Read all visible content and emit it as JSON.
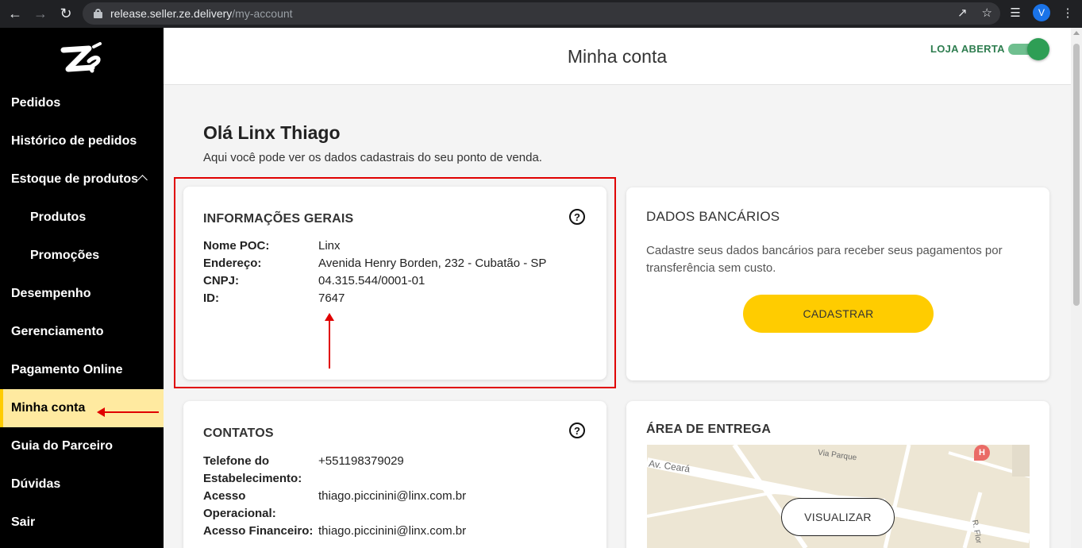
{
  "browser": {
    "url_host": "release.seller.ze.delivery",
    "url_path": "/my-account",
    "profile_initial": "V"
  },
  "sidebar": {
    "items": [
      {
        "label": "Pedidos"
      },
      {
        "label": "Histórico de pedidos"
      },
      {
        "label": "Estoque de produtos"
      },
      {
        "label": "Produtos"
      },
      {
        "label": "Promoções"
      },
      {
        "label": "Desempenho"
      },
      {
        "label": "Gerenciamento"
      },
      {
        "label": "Pagamento Online"
      },
      {
        "label": "Minha conta"
      },
      {
        "label": "Guia do Parceiro"
      },
      {
        "label": "Dúvidas"
      },
      {
        "label": "Sair"
      }
    ]
  },
  "header": {
    "title": "Minha conta",
    "store_status": "LOJA ABERTA"
  },
  "main": {
    "greeting": "Olá Linx Thiago",
    "subtitle": "Aqui você pode ver os dados cadastrais do seu ponto de venda."
  },
  "general_info": {
    "title": "INFORMAÇÕES GERAIS",
    "help": "?",
    "rows": [
      {
        "label": "Nome POC:",
        "value": "Linx"
      },
      {
        "label": "Endereço:",
        "value": "Avenida Henry Borden, 232 - Cubatão - SP"
      },
      {
        "label": "CNPJ:",
        "value": "04.315.544/0001-01"
      },
      {
        "label": "ID:",
        "value": "7647"
      }
    ]
  },
  "bank": {
    "title": "DADOS BANCÁRIOS",
    "text_line1": "Cadastre seus dados bancários para receber seus pagamentos por",
    "text_line2": "transferência sem custo.",
    "button": "CADASTRAR"
  },
  "contacts": {
    "title": "CONTATOS",
    "help": "?",
    "phone_label_1": "Telefone do",
    "phone_label_2": "Estabelecimento:",
    "phone_value": "+551198379029",
    "op_label_1": "Acesso",
    "op_label_2": "Operacional:",
    "op_value": "thiago.piccinini@linx.com.br",
    "fin_label": "Acesso Financeiro:",
    "fin_value": "thiago.piccinini@linx.com.br"
  },
  "delivery": {
    "title": "ÁREA DE ENTREGA",
    "map_label_1": "Av. Ceará",
    "map_label_2": "Via Parque",
    "map_label_3": "R. Flor",
    "button": "VISUALIZAR"
  },
  "colors": {
    "accent_yellow": "#ffcc00",
    "active_item_bg": "#ffeaa0",
    "status_green": "#2e7d4f",
    "annotation_red": "#e00000"
  }
}
